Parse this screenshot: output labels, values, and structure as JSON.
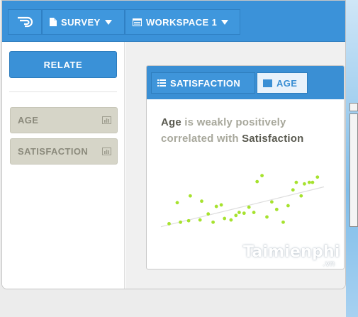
{
  "toolbar": {
    "survey_label": "SURVEY",
    "workspace_label": "WORKSPACE 1"
  },
  "sidebar": {
    "relate_label": "RELATE",
    "variables": [
      {
        "label": "AGE"
      },
      {
        "label": "SATISFACTION"
      }
    ]
  },
  "card": {
    "tabs": [
      {
        "label": "SATISFACTION",
        "icon": "list-icon"
      },
      {
        "label": "AGE",
        "icon": "bar-chart-icon",
        "active": true
      }
    ],
    "headline": {
      "subject": "Age",
      "text1": " is weakly positively correlated with ",
      "object": "Satisfaction"
    }
  },
  "colors": {
    "toolbar_blue": "#3b92d9",
    "variable_chip": "#d6d5c8",
    "point_green": "#a6e22e",
    "trend_line": "#dedede"
  },
  "chart_data": {
    "type": "scatter",
    "title": "",
    "xlabel": "",
    "ylabel": "",
    "grid": false,
    "trendline": {
      "from": [
        0,
        5
      ],
      "to": [
        100,
        58
      ]
    },
    "points": [
      {
        "x": 5,
        "y": 9
      },
      {
        "x": 12,
        "y": 11
      },
      {
        "x": 17,
        "y": 13
      },
      {
        "x": 24,
        "y": 14
      },
      {
        "x": 10,
        "y": 37
      },
      {
        "x": 18,
        "y": 46
      },
      {
        "x": 25,
        "y": 39
      },
      {
        "x": 29,
        "y": 22
      },
      {
        "x": 32,
        "y": 11
      },
      {
        "x": 34,
        "y": 32
      },
      {
        "x": 37,
        "y": 34
      },
      {
        "x": 39,
        "y": 16
      },
      {
        "x": 43,
        "y": 14
      },
      {
        "x": 46,
        "y": 20
      },
      {
        "x": 48,
        "y": 24
      },
      {
        "x": 51,
        "y": 23
      },
      {
        "x": 54,
        "y": 31
      },
      {
        "x": 57,
        "y": 24
      },
      {
        "x": 59,
        "y": 65
      },
      {
        "x": 62,
        "y": 73
      },
      {
        "x": 65,
        "y": 18
      },
      {
        "x": 68,
        "y": 38
      },
      {
        "x": 71,
        "y": 28
      },
      {
        "x": 75,
        "y": 11
      },
      {
        "x": 78,
        "y": 33
      },
      {
        "x": 81,
        "y": 54
      },
      {
        "x": 83,
        "y": 64
      },
      {
        "x": 86,
        "y": 46
      },
      {
        "x": 88,
        "y": 62
      },
      {
        "x": 91,
        "y": 64
      },
      {
        "x": 93,
        "y": 64
      },
      {
        "x": 96,
        "y": 71
      }
    ],
    "xlim": [
      0,
      100
    ],
    "ylim": [
      0,
      100
    ]
  }
}
